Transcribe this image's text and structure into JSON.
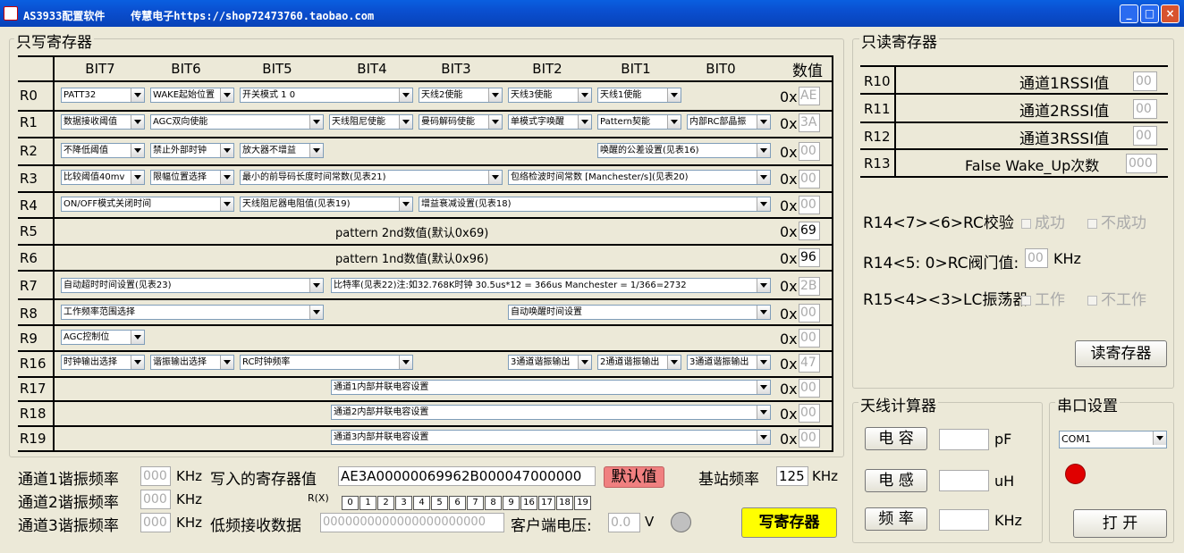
{
  "window": {
    "title": "AS3933配置软件    传慧电子https://shop72473760.taobao.com",
    "minimize": "_",
    "maximize": "□",
    "close": "×"
  },
  "wo": {
    "legend": "只写寄存器",
    "bits": [
      "BIT7",
      "BIT6",
      "BIT5",
      "BIT4",
      "BIT3",
      "BIT2",
      "BIT1",
      "BIT0"
    ],
    "value_header": "数值",
    "ox": "0x",
    "rows": [
      {
        "label": "R0",
        "value": "AE",
        "dd": [
          "PATT32",
          "WAKE起始位置",
          "开关模式  1 0",
          "天线2使能",
          "天线3使能",
          "天线1使能"
        ]
      },
      {
        "label": "R1",
        "value": "3A",
        "dd": [
          "数据接收阈值",
          "AGC双向使能",
          "天线阻尼使能",
          "曼码解码使能",
          "单模式字唤醒",
          "Pattern契能",
          "内部RC部晶振"
        ]
      },
      {
        "label": "R2",
        "value": "00",
        "dd": [
          "不降低阈值",
          "禁止外部时钟",
          "放大器不增益",
          "唤醒的公差设置(见表16)"
        ]
      },
      {
        "label": "R3",
        "value": "00",
        "dd": [
          "比较阈值40mv",
          "限幅位置选择",
          "最小的前导码长度时间常数(见表21)",
          "包络检波时间常数 [Manchester/s](见表20)"
        ]
      },
      {
        "label": "R4",
        "value": "00",
        "dd": [
          "ON/OFF模式关闭时间",
          "天线阻尼器电阻值(见表19)",
          "增益衰减设置(见表18)"
        ]
      },
      {
        "label": "R5",
        "value": "69",
        "text": "pattern 2nd数值(默认0x69)"
      },
      {
        "label": "R6",
        "value": "96",
        "text": "pattern 1nd数值(默认0x96)"
      },
      {
        "label": "R7",
        "value": "2B",
        "dd": [
          "自动超时时间设置(见表23)",
          "比特率(见表22)注:如32.768K时钟 30.5us*12 = 366us  Manchester = 1/366=2732"
        ]
      },
      {
        "label": "R8",
        "value": "00",
        "dd": [
          "工作频率范围选择",
          "自动唤醒时间设置"
        ]
      },
      {
        "label": "R9",
        "value": "00",
        "dd": [
          "AGC控制位"
        ]
      },
      {
        "label": "R16",
        "value": "47",
        "dd": [
          "时钟输出选择",
          "谐振输出选择",
          "RC时钟频率",
          "3通道谐振输出",
          "2通道谐振输出",
          "3通道谐振输出"
        ]
      },
      {
        "label": "R17",
        "value": "00",
        "dd": [
          "通道1内部并联电容设置"
        ]
      },
      {
        "label": "R18",
        "value": "00",
        "dd": [
          "通道2内部并联电容设置"
        ]
      },
      {
        "label": "R19",
        "value": "00",
        "dd": [
          "通道3内部并联电容设置"
        ]
      }
    ]
  },
  "bottom": {
    "ch1": "通道1谐振频率",
    "ch2": "通道2谐振频率",
    "ch3": "通道3谐振频率",
    "ch_val": "000",
    "khz": "KHz",
    "written_label": "写入的寄存器值",
    "written_value": "AE3A00000069962B000047000000",
    "default_btn": "默认值",
    "lf_label": "低频接收数据",
    "lf_value": "0000000000000000000000",
    "r_label": "R(X)",
    "r_cells": [
      "0",
      "1",
      "2",
      "3",
      "4",
      "5",
      "6",
      "7",
      "8",
      "9",
      "16",
      "17",
      "18",
      "19"
    ],
    "base_label": "基站频率",
    "base_value": "125",
    "client_label": "客户端电压:",
    "client_value": "0.0",
    "volt": "V",
    "write_btn": "写寄存器"
  },
  "ro": {
    "legend": "只读寄存器",
    "rows": [
      {
        "label": "R10",
        "name": "通道1RSSI值",
        "value": "00"
      },
      {
        "label": "R11",
        "name": "通道2RSSI值",
        "value": "00"
      },
      {
        "label": "R12",
        "name": "通道3RSSI值",
        "value": "00"
      },
      {
        "label": "R13",
        "name": "False Wake_Up次数",
        "value": "000"
      }
    ],
    "r14_label": "R14<7><6>RC校验",
    "success": "成功",
    "fail": "不成功",
    "r14b_label": "R14<5: 0>RC阀门值:",
    "r14b_value": "00",
    "khz": "KHz",
    "r15_label": "R15<4><3>LC振荡器",
    "work": "工作",
    "nowork": "不工作",
    "read_btn": "读寄存器"
  },
  "ant": {
    "legend": "天线计算器",
    "cap": "电 容",
    "ind": "电 感",
    "freq": "频 率",
    "pf": "pF",
    "uh": "uH",
    "khz": "KHz"
  },
  "serial": {
    "legend": "串口设置",
    "port": "COM1",
    "open": "打 开",
    "status_color": "#e00000"
  }
}
